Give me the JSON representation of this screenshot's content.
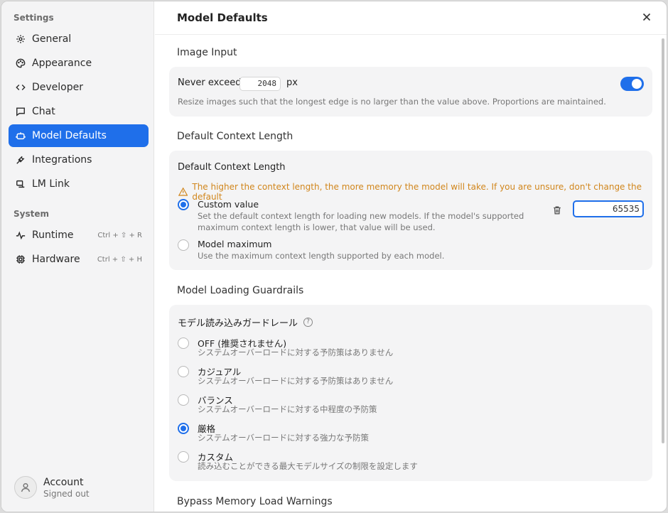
{
  "sidebar": {
    "settings_label": "Settings",
    "system_label": "System",
    "items": [
      {
        "label": "General",
        "icon": "gear-icon"
      },
      {
        "label": "Appearance",
        "icon": "palette-icon"
      },
      {
        "label": "Developer",
        "icon": "code-icon"
      },
      {
        "label": "Chat",
        "icon": "chat-icon"
      },
      {
        "label": "Model Defaults",
        "icon": "robot-icon",
        "active": true
      },
      {
        "label": "Integrations",
        "icon": "plug-icon"
      },
      {
        "label": "LM Link",
        "icon": "link-icon"
      }
    ],
    "system_items": [
      {
        "label": "Runtime",
        "icon": "pulse-icon",
        "shortcut": "Ctrl + ⇧ + R"
      },
      {
        "label": "Hardware",
        "icon": "chip-icon",
        "shortcut": "Ctrl + ⇧ + H"
      }
    ],
    "account": {
      "name": "Account",
      "status": "Signed out"
    }
  },
  "main": {
    "title": "Model Defaults",
    "image_input": {
      "heading": "Image Input",
      "label": "Never exceed",
      "value": "2048",
      "unit": "px",
      "enabled": true,
      "description": "Resize images such that the longest edge is no larger than the value above. Proportions are maintained."
    },
    "context": {
      "heading": "Default Context Length",
      "card_title": "Default Context Length",
      "warning": "The higher the context length, the more memory the model will take. If you are unsure, don't change the default",
      "custom_title": "Custom value",
      "custom_desc_1": "Set the default context length for loading new models. If the model's supported",
      "custom_desc_2": "maximum context length is lower, that value will be used.",
      "custom_value": "65535",
      "max_title": "Model maximum",
      "max_desc": "Use the maximum context length supported by each model."
    },
    "guardrails": {
      "heading": "Model Loading Guardrails",
      "card_title": "モデル読み込みガードレール",
      "help": "?",
      "options": [
        {
          "title": "OFF (推奨されません)",
          "desc": "システムオーバーロードに対する予防策はありません",
          "selected": false
        },
        {
          "title": "カジュアル",
          "desc": "システムオーバーロードに対する予防策はありません",
          "selected": false
        },
        {
          "title": "バランス",
          "desc": "システムオーバーロードに対する中程度の予防策",
          "selected": false
        },
        {
          "title": "厳格",
          "desc": "システムオーバーロードに対する強力な予防策",
          "selected": true
        },
        {
          "title": "カスタム",
          "desc": "読み込むことができる最大モデルサイズの制限を設定します",
          "selected": false
        }
      ]
    },
    "bypass_heading": "Bypass Memory Load Warnings"
  },
  "colors": {
    "accent": "#1f6fea",
    "warning": "#d1861c",
    "sidebar_bg": "#f4f4f5"
  }
}
